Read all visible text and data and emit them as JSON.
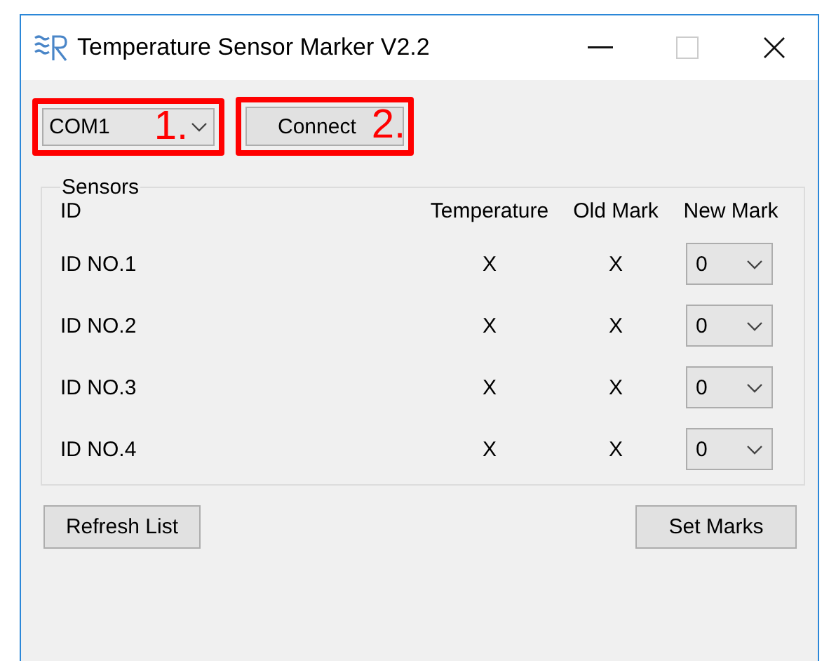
{
  "window": {
    "title": "Temperature Sensor Marker V2.2"
  },
  "port": {
    "value": "COM1",
    "annotation": "1."
  },
  "connect": {
    "label": "Connect",
    "annotation": "2."
  },
  "sensors": {
    "legend": "Sensors",
    "columns": [
      "ID",
      "Temperature",
      "Old Mark",
      "New Mark"
    ],
    "rows": [
      {
        "id": "ID NO.1",
        "temperature": "X",
        "old_mark": "X",
        "new_mark": "0"
      },
      {
        "id": "ID NO.2",
        "temperature": "X",
        "old_mark": "X",
        "new_mark": "0"
      },
      {
        "id": "ID NO.3",
        "temperature": "X",
        "old_mark": "X",
        "new_mark": "0"
      },
      {
        "id": "ID NO.4",
        "temperature": "X",
        "old_mark": "X",
        "new_mark": "0"
      }
    ]
  },
  "buttons": [
    "Refresh List",
    "Set Marks"
  ]
}
